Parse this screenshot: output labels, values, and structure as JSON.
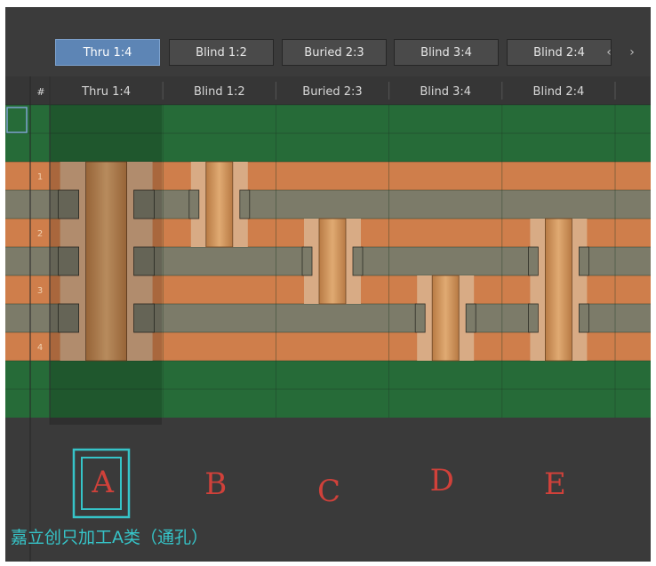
{
  "tabs": [
    {
      "label": "Thru 1:4",
      "active": true
    },
    {
      "label": "Blind 1:2",
      "active": false
    },
    {
      "label": "Buried 2:3",
      "active": false
    },
    {
      "label": "Blind 3:4",
      "active": false
    },
    {
      "label": "Blind 2:4",
      "active": false
    }
  ],
  "nav": {
    "prev": "‹",
    "next": "›"
  },
  "grid": {
    "hash_label": "#",
    "columns": [
      "Thru 1:4",
      "Blind 1:2",
      "Buried 2:3",
      "Blind 3:4",
      "Blind 2:4"
    ],
    "layer_numbers": [
      "1",
      "2",
      "3",
      "4"
    ]
  },
  "vias": [
    {
      "letter": "A",
      "type": "thru",
      "span": [
        1,
        4
      ]
    },
    {
      "letter": "B",
      "type": "blind",
      "span": [
        1,
        2
      ]
    },
    {
      "letter": "C",
      "type": "buried",
      "span": [
        2,
        3
      ]
    },
    {
      "letter": "D",
      "type": "blind",
      "span": [
        3,
        4
      ]
    },
    {
      "letter": "E",
      "type": "blind",
      "span": [
        2,
        4
      ]
    }
  ],
  "caption": "嘉立创只加工A类（通孔）",
  "colors": {
    "solder_mask": "#266b38",
    "copper": "#cf7e4b",
    "dielectric": "#7c7b69",
    "via_barrel": "#c98e58",
    "clearance": "#d8ab85",
    "highlight": "#36c4c8",
    "letter": "#d0413a"
  }
}
